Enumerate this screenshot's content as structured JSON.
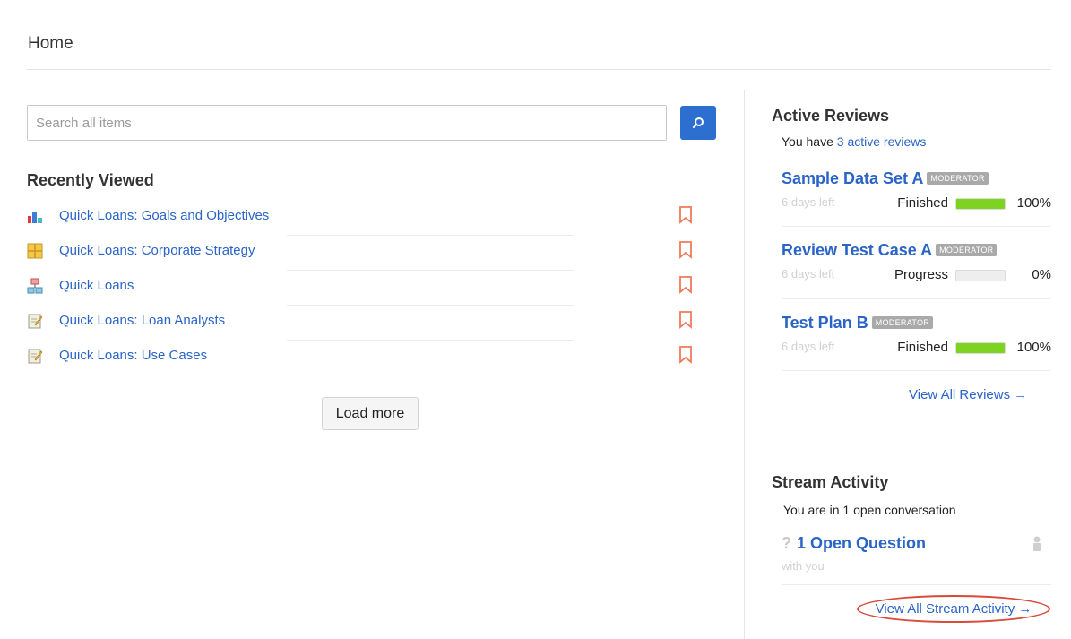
{
  "page": {
    "title": "Home"
  },
  "search": {
    "placeholder": "Search all items",
    "value": "",
    "icon": "search-icon"
  },
  "recently_viewed": {
    "title": "Recently Viewed",
    "items": [
      {
        "label": "Quick Loans: Goals and Objectives",
        "icon": "chart-icon"
      },
      {
        "label": "Quick Loans: Corporate Strategy",
        "icon": "grid-icon"
      },
      {
        "label": "Quick Loans",
        "icon": "hierarchy-icon"
      },
      {
        "label": "Quick Loans: Loan Analysts",
        "icon": "document-edit-icon"
      },
      {
        "label": "Quick Loans: Use Cases",
        "icon": "document-edit-icon"
      }
    ],
    "load_more": "Load more"
  },
  "active_reviews": {
    "title": "Active Reviews",
    "summary_prefix": "You have ",
    "summary_link": "3 active reviews",
    "reviews": [
      {
        "name": "Sample Data Set A",
        "role": "MODERATOR",
        "ago": "6 days left",
        "status": "Finished",
        "progress": 100,
        "percent": "100%"
      },
      {
        "name": "Review Test Case A",
        "role": "MODERATOR",
        "ago": "6 days left",
        "status": "Progress",
        "progress": 0,
        "percent": "0%"
      },
      {
        "name": "Test Plan B",
        "role": "MODERATOR",
        "ago": "6 days left",
        "status": "Finished",
        "progress": 100,
        "percent": "100%"
      }
    ],
    "view_all": "View All Reviews →"
  },
  "stream_activity": {
    "title": "Stream Activity",
    "summary": "You are in 1 open conversation",
    "question_mark": "?",
    "question": "1 Open Question",
    "with_you": "with you",
    "view_all": "View All Stream Activity →"
  },
  "colors": {
    "link": "#2a64c7",
    "search_button": "#2c6fd1",
    "progress_fill": "#7ed321",
    "bookmark": "#f07a5a",
    "highlight_ring": "#d84a3a"
  }
}
